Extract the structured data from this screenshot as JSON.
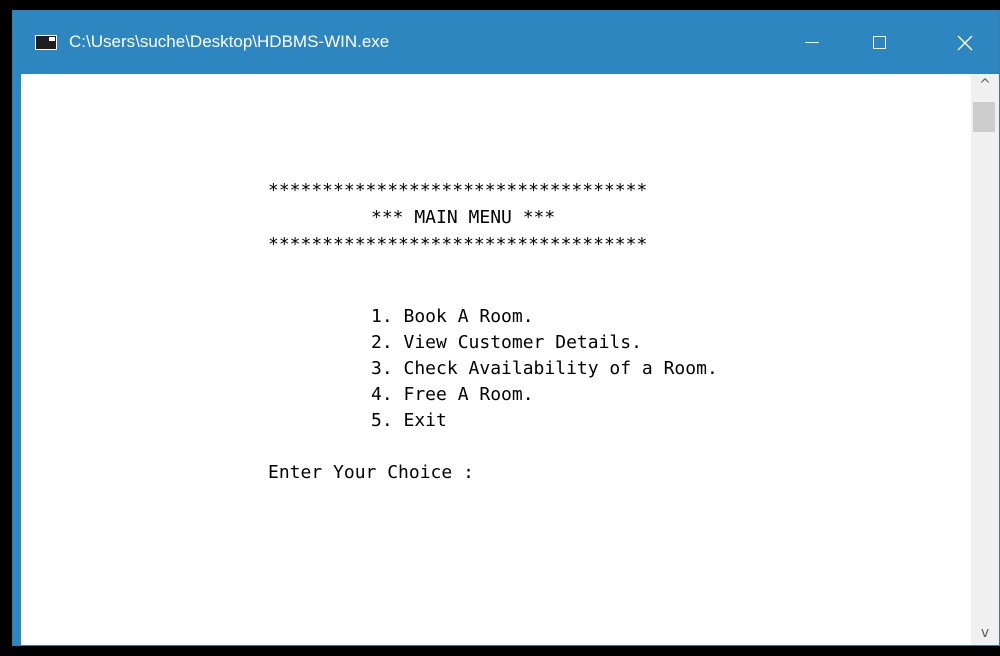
{
  "window": {
    "title": "C:\\Users\\suche\\Desktop\\HDBMS-WIN.exe",
    "icon": "console-app-icon",
    "controls": [
      "minimize",
      "maximize",
      "close"
    ]
  },
  "console": {
    "banner_top": "***********************************",
    "banner_title": "*** MAIN MENU ***",
    "banner_bottom": "***********************************",
    "menu_items": [
      "1. Book A Room.",
      "2. View Customer Details.",
      "3. Check Availability of a Room.",
      "4. Free A Room.",
      "5. Exit"
    ],
    "prompt": "Enter Your Choice :"
  },
  "scrollbar": {
    "up_glyph": "^",
    "down_glyph": "v"
  },
  "colors": {
    "titlebar": "#2e86c1",
    "console_bg": "#ffffff",
    "console_text": "#000000"
  }
}
